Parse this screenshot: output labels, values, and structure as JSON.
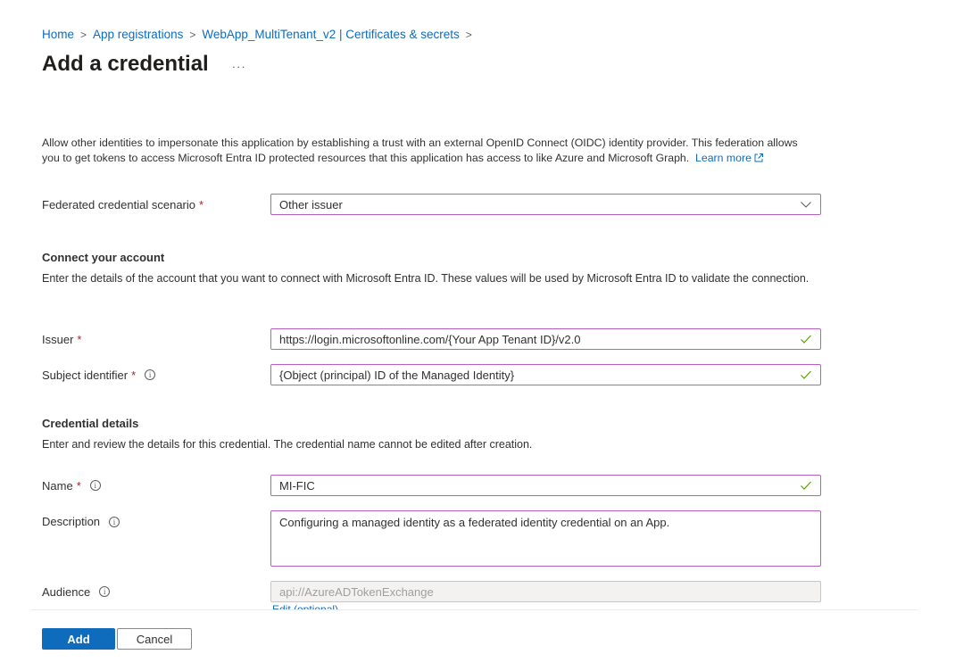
{
  "breadcrumb": {
    "items": [
      "Home",
      "App registrations",
      "WebApp_MultiTenant_v2 | Certificates & secrets"
    ],
    "separator": ">"
  },
  "header": {
    "title": "Add a credential",
    "more_label": "···"
  },
  "intro": {
    "text": "Allow other identities to impersonate this application by establishing a trust with an external OpenID Connect (OIDC) identity provider. This federation allows you to get tokens to access Microsoft Entra ID protected resources that this application has access to like Azure and Microsoft Graph.",
    "learn_more": "Learn more"
  },
  "scenario": {
    "label": "Federated credential scenario",
    "required": "*",
    "value": "Other issuer"
  },
  "connect_section": {
    "heading": "Connect your account",
    "description": "Enter the details of the account that you want to connect with Microsoft Entra ID. These values will be used by Microsoft Entra ID to validate the connection."
  },
  "issuer": {
    "label": "Issuer",
    "required": "*",
    "value": "https://login.microsoftonline.com/{Your App Tenant ID}/v2.0"
  },
  "subject": {
    "label": "Subject identifier",
    "required": "*",
    "info": "i",
    "value": "{Object (principal) ID of the Managed Identity}"
  },
  "details_section": {
    "heading": "Credential details",
    "description": "Enter and review the details for this credential. The credential name cannot be edited after creation."
  },
  "name": {
    "label": "Name",
    "required": "*",
    "info": "i",
    "value": "MI-FIC"
  },
  "description": {
    "label": "Description",
    "info": "i",
    "value": "Configuring a managed identity as a federated identity credential on an App."
  },
  "audience": {
    "label": "Audience",
    "info": "i",
    "value": "api://AzureADTokenExchange",
    "edit_link": "Edit (optional)"
  },
  "footer": {
    "add_label": "Add",
    "cancel_label": "Cancel"
  },
  "colors": {
    "accent": "#0f6cbd",
    "field_border": "#b75fc4",
    "valid_check": "#57a300",
    "required": "#a4262c"
  }
}
